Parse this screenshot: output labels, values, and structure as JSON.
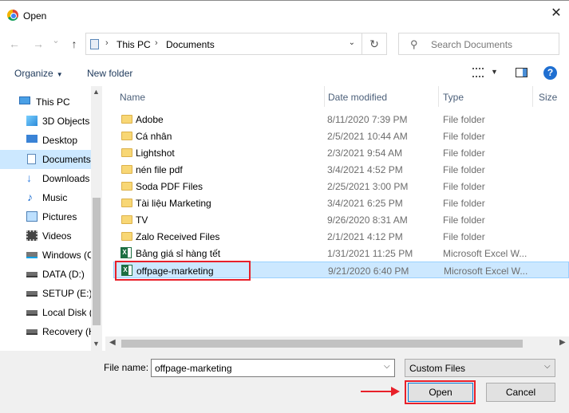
{
  "window": {
    "title": "Open",
    "close_glyph": "✕"
  },
  "nav": {
    "back_glyph": "←",
    "forward_glyph": "→",
    "dropdown_glyph": "⌄",
    "up_glyph": "↑",
    "breadcrumb": [
      "This PC",
      "Documents"
    ],
    "sep_glyph": "›",
    "refresh_glyph": "↻",
    "search_placeholder": "Search Documents"
  },
  "toolbar": {
    "organize": "Organize",
    "new_folder": "New folder",
    "help_glyph": "?"
  },
  "sidebar": {
    "items": [
      {
        "label": "This PC",
        "icon": "computer-icon"
      },
      {
        "label": "3D Objects",
        "icon": "cube-icon"
      },
      {
        "label": "Desktop",
        "icon": "desktop-icon"
      },
      {
        "label": "Documents",
        "icon": "document-icon",
        "selected": true
      },
      {
        "label": "Downloads",
        "icon": "download-icon"
      },
      {
        "label": "Music",
        "icon": "music-icon"
      },
      {
        "label": "Pictures",
        "icon": "picture-icon"
      },
      {
        "label": "Videos",
        "icon": "video-icon"
      },
      {
        "label": "Windows (C",
        "icon": "windows-drive-icon"
      },
      {
        "label": "DATA (D:)",
        "icon": "drive-icon"
      },
      {
        "label": "SETUP (E:)",
        "icon": "drive-icon"
      },
      {
        "label": "Local Disk (",
        "icon": "drive-icon"
      },
      {
        "label": "Recovery (H",
        "icon": "drive-icon"
      }
    ]
  },
  "columns": {
    "name": "Name",
    "date": "Date modified",
    "type": "Type",
    "size": "Size"
  },
  "files": [
    {
      "name": "Adobe",
      "date": "8/11/2020 7:39 PM",
      "type": "File folder",
      "kind": "folder"
    },
    {
      "name": "Cá nhân",
      "date": "2/5/2021 10:44 AM",
      "type": "File folder",
      "kind": "folder"
    },
    {
      "name": "Lightshot",
      "date": "2/3/2021 9:54 AM",
      "type": "File folder",
      "kind": "folder"
    },
    {
      "name": "nén file pdf",
      "date": "3/4/2021 4:52 PM",
      "type": "File folder",
      "kind": "folder"
    },
    {
      "name": "Soda PDF Files",
      "date": "2/25/2021 3:00 PM",
      "type": "File folder",
      "kind": "folder"
    },
    {
      "name": "Tài liệu Marketing",
      "date": "3/4/2021 6:25 PM",
      "type": "File folder",
      "kind": "folder"
    },
    {
      "name": "TV",
      "date": "9/26/2020 8:31 AM",
      "type": "File folder",
      "kind": "folder"
    },
    {
      "name": "Zalo Received Files",
      "date": "2/1/2021 4:12 PM",
      "type": "File folder",
      "kind": "folder"
    },
    {
      "name": "Bảng giá sỉ hàng tết",
      "date": "1/31/2021 11:25 PM",
      "type": "Microsoft Excel W...",
      "kind": "excel"
    },
    {
      "name": "offpage-marketing",
      "date": "9/21/2020 6:40 PM",
      "type": "Microsoft Excel W...",
      "kind": "excel",
      "selected": true
    }
  ],
  "bottom": {
    "file_name_label": "File name:",
    "file_name_value": "offpage-marketing",
    "filter_value": "Custom Files",
    "open_label": "Open",
    "cancel_label": "Cancel"
  },
  "colors": {
    "highlight_red": "#e8202a",
    "selection_blue": "#cce8ff"
  }
}
